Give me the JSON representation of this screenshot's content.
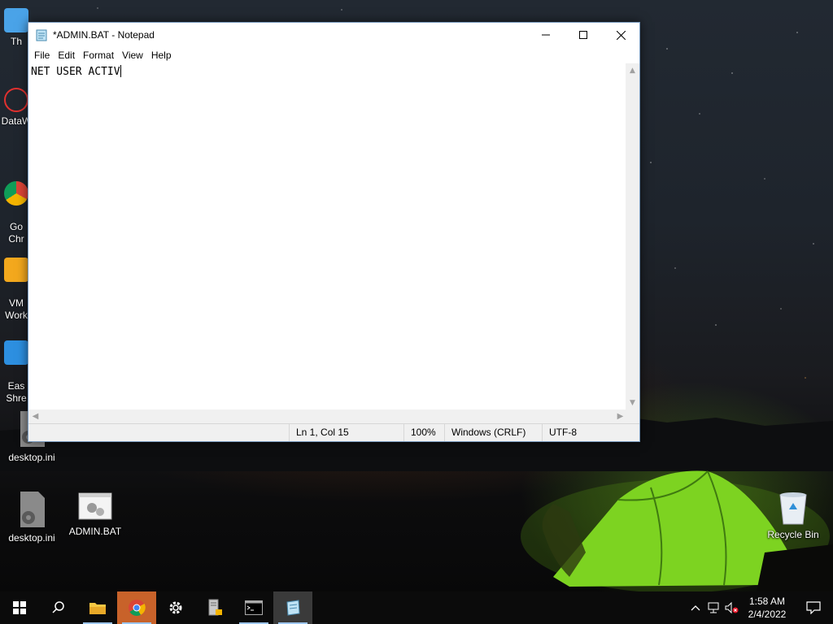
{
  "desktop": {
    "partial_icons": [
      {
        "label": "Th"
      },
      {
        "label": "DataW"
      },
      {
        "label": "Go\nChr"
      },
      {
        "label": "VM\nWork"
      },
      {
        "label": "Eas\nShre"
      }
    ],
    "icons": [
      {
        "label": "desktop.ini"
      },
      {
        "label": "desktop.ini"
      },
      {
        "label": "ADMIN.BAT"
      },
      {
        "label": "Recycle Bin"
      }
    ]
  },
  "window": {
    "title": "*ADMIN.BAT - Notepad",
    "menu": [
      "File",
      "Edit",
      "Format",
      "View",
      "Help"
    ],
    "content": "NET USER ACTIV",
    "status": {
      "position": "Ln 1, Col 15",
      "zoom": "100%",
      "line_ending": "Windows (CRLF)",
      "encoding": "UTF-8"
    }
  },
  "taskbar": {
    "buttons": [
      "start-icon",
      "search-icon",
      "file-explorer-icon",
      "chrome-icon",
      "settings-icon",
      "server-manager-icon",
      "command-prompt-icon",
      "notepad-icon"
    ],
    "clock": {
      "time": "1:58 AM",
      "date": "2/4/2022"
    }
  },
  "colors": {
    "accent": "#0078d7",
    "taskbar": "#0b0b0b",
    "tent": "#7dd321"
  }
}
